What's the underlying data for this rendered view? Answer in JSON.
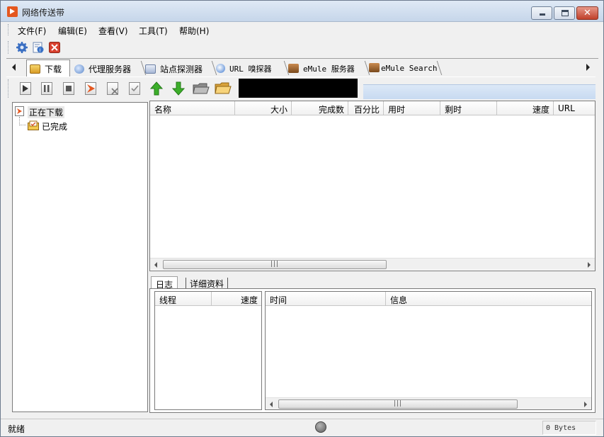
{
  "window": {
    "title": "网络传送带"
  },
  "menu": [
    {
      "label": "文件(F)"
    },
    {
      "label": "编辑(E)"
    },
    {
      "label": "查看(V)"
    },
    {
      "label": "工具(T)"
    },
    {
      "label": "帮助(H)"
    }
  ],
  "quickbar": {
    "icons": [
      "settings-gear-icon",
      "info-icon",
      "close-red-icon"
    ]
  },
  "tabs": [
    {
      "label": "下载",
      "icon": "download-folder-icon",
      "active": true
    },
    {
      "label": "代理服务器",
      "icon": "globe-icon",
      "active": false
    },
    {
      "label": "站点探测器",
      "icon": "site-probe-icon",
      "active": false
    },
    {
      "label": "URL 嗅探器",
      "icon": "magnifier-icon",
      "active": false
    },
    {
      "label": "eMule 服务器",
      "icon": "emule-mule-icon",
      "active": false
    },
    {
      "label": "eMule Search",
      "icon": "emule-mule-icon",
      "active": false
    }
  ],
  "actions": [
    "start-icon",
    "pause-icon",
    "stop-icon",
    "new-task-icon",
    "delete-icon",
    "check-icon",
    "move-up-arrow-icon",
    "move-down-arrow-icon",
    "open-folder-icon",
    "folder-icon"
  ],
  "tree": {
    "items": [
      {
        "label": "正在下载",
        "icon": "downloading-icon"
      },
      {
        "label": "已完成",
        "icon": "completed-icon"
      }
    ]
  },
  "file_list": {
    "columns": [
      "名称",
      "大小",
      "完成数",
      "百分比",
      "用时",
      "剩时",
      "速度",
      "URL"
    ],
    "rows": []
  },
  "bottom": {
    "tabs": [
      {
        "label": "日志",
        "active": true
      },
      {
        "label": "详细资料",
        "active": false
      }
    ],
    "thread_columns": [
      "线程",
      "速度"
    ],
    "log_columns": [
      "时间",
      "信息"
    ]
  },
  "status": {
    "text": "就绪",
    "bytes": "0 Bytes"
  },
  "colors": {
    "accent": "#e4571f",
    "arrow_green": "#3cae2a",
    "selected_tab_bg": "#ffffff"
  }
}
